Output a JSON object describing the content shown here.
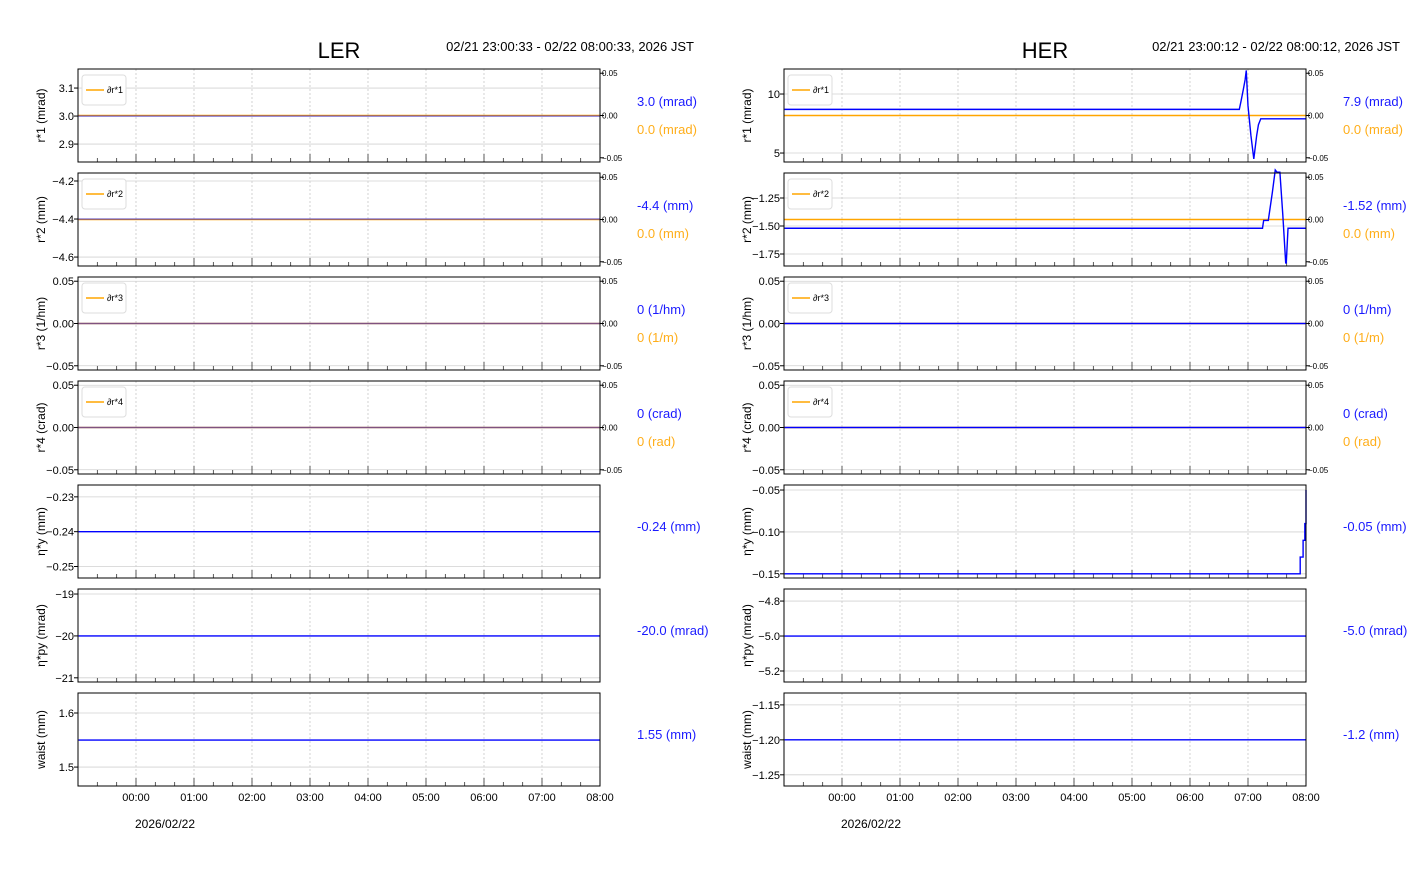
{
  "chart_data": [
    {
      "type": "line",
      "title": "LER",
      "time_range": "02/21 23:00:33 - 02/22 08:00:33, 2026 JST",
      "date_label": "2026/02/22",
      "x_ticks": [
        "00:00",
        "01:00",
        "02:00",
        "03:00",
        "04:00",
        "05:00",
        "06:00",
        "07:00",
        "08:00"
      ],
      "x_range_hours": [
        -0.99,
        8.0
      ],
      "panels": [
        {
          "ylabel": "r*1 (mrad)",
          "ylim": [
            2.836,
            3.168
          ],
          "yticks": [
            2.9,
            3.0,
            3.1
          ],
          "tick_fmt": 1,
          "right_axis": true,
          "legend": "∂r*1",
          "value_label": "3.0 (mrad)",
          "delta_label": "0.0 (mrad)",
          "series": {
            "t": [
              -0.99,
              8.0
            ],
            "v": [
              3.0,
              3.0
            ]
          },
          "delta": {
            "t": [
              -0.99,
              8.0
            ],
            "v": [
              0,
              0
            ]
          }
        },
        {
          "ylabel": "r*2 (mm)",
          "ylim": [
            -4.647,
            -4.158
          ],
          "yticks": [
            -4.6,
            -4.4,
            -4.2
          ],
          "tick_fmt": 1,
          "right_axis": true,
          "legend": "∂r*2",
          "value_label": "-4.4 (mm)",
          "delta_label": "0.0 (mm)",
          "series": {
            "t": [
              -0.99,
              8.0
            ],
            "v": [
              -4.4,
              -4.4
            ]
          },
          "delta": {
            "t": [
              -0.99,
              8.0
            ],
            "v": [
              0,
              0
            ]
          }
        },
        {
          "ylabel": "r*3 (1/hm)",
          "ylim": [
            -0.055,
            0.055
          ],
          "yticks": [
            -0.05,
            0.0,
            0.05
          ],
          "tick_fmt": 2,
          "right_axis": true,
          "legend": "∂r*3",
          "value_label": "0 (1/hm)",
          "delta_label": "0 (1/m)",
          "series": {
            "t": [
              -0.99,
              8.0
            ],
            "v": [
              0,
              0
            ]
          },
          "delta": {
            "t": [
              -0.99,
              8.0
            ],
            "v": [
              0,
              0
            ]
          }
        },
        {
          "ylabel": "r*4 (crad)",
          "ylim": [
            -0.055,
            0.055
          ],
          "yticks": [
            -0.05,
            0.0,
            0.05
          ],
          "tick_fmt": 2,
          "right_axis": true,
          "legend": "∂r*4",
          "value_label": "0 (crad)",
          "delta_label": "0 (rad)",
          "series": {
            "t": [
              -0.99,
              8.0
            ],
            "v": [
              0,
              0
            ]
          },
          "delta": {
            "t": [
              -0.99,
              8.0
            ],
            "v": [
              0,
              0
            ]
          }
        },
        {
          "ylabel": "η*y (mm)",
          "ylim": [
            -0.2533,
            -0.2266
          ],
          "yticks": [
            -0.25,
            -0.24,
            -0.23
          ],
          "tick_fmt": 2,
          "right_axis": false,
          "value_label": "-0.24 (mm)",
          "series": {
            "t": [
              -0.99,
              8.0
            ],
            "v": [
              -0.24,
              -0.24
            ]
          }
        },
        {
          "ylabel": "η*py (mrad)",
          "ylim": [
            -21.1,
            -18.88
          ],
          "yticks": [
            -21,
            -20,
            -19
          ],
          "tick_fmt": 0,
          "right_axis": false,
          "value_label": "-20.0 (mrad)",
          "series": {
            "t": [
              -0.99,
              8.0
            ],
            "v": [
              -20.0,
              -20.0
            ]
          }
        },
        {
          "ylabel": "waist (mm)",
          "ylim": [
            1.465,
            1.637
          ],
          "yticks": [
            1.5,
            1.6
          ],
          "tick_fmt": 1,
          "right_axis": false,
          "value_label": "1.55 (mm)",
          "series": {
            "t": [
              -0.99,
              8.0
            ],
            "v": [
              1.55,
              1.55
            ]
          }
        }
      ]
    },
    {
      "type": "line",
      "title": "HER",
      "time_range": "02/21 23:00:12 - 02/22 08:00:12, 2026 JST",
      "date_label": "2026/02/22",
      "x_ticks": [
        "00:00",
        "01:00",
        "02:00",
        "03:00",
        "04:00",
        "05:00",
        "06:00",
        "07:00",
        "08:00"
      ],
      "x_range_hours": [
        -1.0,
        8.0
      ],
      "panels": [
        {
          "ylabel": "r*1 (mrad)",
          "ylim": [
            4.24,
            12.12
          ],
          "yticks": [
            5,
            10
          ],
          "tick_fmt": 0,
          "right_axis": true,
          "legend": "∂r*1",
          "value_label": "7.9 (mrad)",
          "delta_label": "0.0 (mrad)",
          "series": {
            "t": [
              -1.0,
              6.85,
              6.88,
              6.92,
              6.95,
              6.97,
              7.0,
              7.05,
              7.1,
              7.15,
              7.18,
              7.22,
              8.0
            ],
            "v": [
              8.7,
              8.7,
              9.4,
              10.4,
              11.2,
              12.0,
              9.0,
              6.5,
              4.5,
              6.5,
              7.4,
              7.9,
              7.9
            ]
          },
          "delta": {
            "t": [
              -1.0,
              8.0
            ],
            "v": [
              0,
              0
            ]
          }
        },
        {
          "ylabel": "r*2 (mm)",
          "ylim": [
            -1.857,
            -1.027
          ],
          "yticks": [
            -1.75,
            -1.5,
            -1.25
          ],
          "tick_fmt": 2,
          "right_axis": true,
          "legend": "∂r*2",
          "value_label": "-1.52 (mm)",
          "delta_label": "0.0 (mm)",
          "series": {
            "t": [
              -1.0,
              7.25,
              7.27,
              7.35,
              7.42,
              7.47,
              7.5,
              7.55,
              7.6,
              7.65,
              7.66,
              7.69,
              8.0
            ],
            "v": [
              -1.52,
              -1.52,
              -1.45,
              -1.45,
              -1.2,
              -1.0,
              -1.02,
              -1.02,
              -1.4,
              -1.83,
              -1.83,
              -1.52,
              -1.52
            ]
          },
          "delta": {
            "t": [
              -1.0,
              8.0
            ],
            "v": [
              0,
              0
            ]
          }
        },
        {
          "ylabel": "r*3 (1/hm)",
          "ylim": [
            -0.055,
            0.055
          ],
          "yticks": [
            -0.05,
            0.0,
            0.05
          ],
          "tick_fmt": 2,
          "right_axis": true,
          "legend": "∂r*3",
          "value_label": "0 (1/hm)",
          "delta_label": "0 (1/m)",
          "series": {
            "t": [
              -1.0,
              8.0
            ],
            "v": [
              0,
              0
            ]
          },
          "delta": {
            "t": [
              -1.0,
              8.0
            ],
            "v": [
              0,
              0
            ]
          }
        },
        {
          "ylabel": "r*4 (crad)",
          "ylim": [
            -0.055,
            0.055
          ],
          "yticks": [
            -0.05,
            0.0,
            0.05
          ],
          "tick_fmt": 2,
          "right_axis": true,
          "legend": "∂r*4",
          "value_label": "0 (crad)",
          "delta_label": "0 (rad)",
          "series": {
            "t": [
              -1.0,
              8.0
            ],
            "v": [
              0,
              0
            ]
          },
          "delta": {
            "t": [
              -1.0,
              8.0
            ],
            "v": [
              0,
              0
            ]
          }
        },
        {
          "ylabel": "η*y (mm)",
          "ylim": [
            -0.155,
            -0.044
          ],
          "yticks": [
            -0.15,
            -0.1,
            -0.05
          ],
          "tick_fmt": 2,
          "right_axis": false,
          "value_label": "-0.05 (mm)",
          "series": {
            "t": [
              -1.0,
              7.9,
              7.9,
              7.95,
              7.95,
              7.98,
              7.98,
              8.0,
              8.0
            ],
            "v": [
              -0.15,
              -0.15,
              -0.13,
              -0.13,
              -0.11,
              -0.11,
              -0.09,
              -0.09,
              -0.05
            ]
          }
        },
        {
          "ylabel": "η*py (mrad)",
          "ylim": [
            -5.263,
            -4.731
          ],
          "yticks": [
            -5.2,
            -5.0,
            -4.8
          ],
          "tick_fmt": 1,
          "right_axis": false,
          "value_label": "-5.0 (mrad)",
          "series": {
            "t": [
              -1.0,
              8.0
            ],
            "v": [
              -5.0,
              -5.0
            ]
          }
        },
        {
          "ylabel": "waist (mm)",
          "ylim": [
            -1.266,
            -1.133
          ],
          "yticks": [
            -1.25,
            -1.2,
            -1.15
          ],
          "tick_fmt": 2,
          "right_axis": false,
          "value_label": "-1.2 (mm)",
          "series": {
            "t": [
              -1.0,
              8.0
            ],
            "v": [
              -1.2,
              -1.2
            ]
          }
        }
      ]
    }
  ],
  "right_axis_ticks": [
    "0.05",
    "0.00",
    "−0.05"
  ],
  "colors": {
    "blue": "#0000ff",
    "orange": "#ffa500",
    "grid": "#cccccc",
    "label_blue": "#1a1aff",
    "label_orange": "#ffae1a"
  }
}
